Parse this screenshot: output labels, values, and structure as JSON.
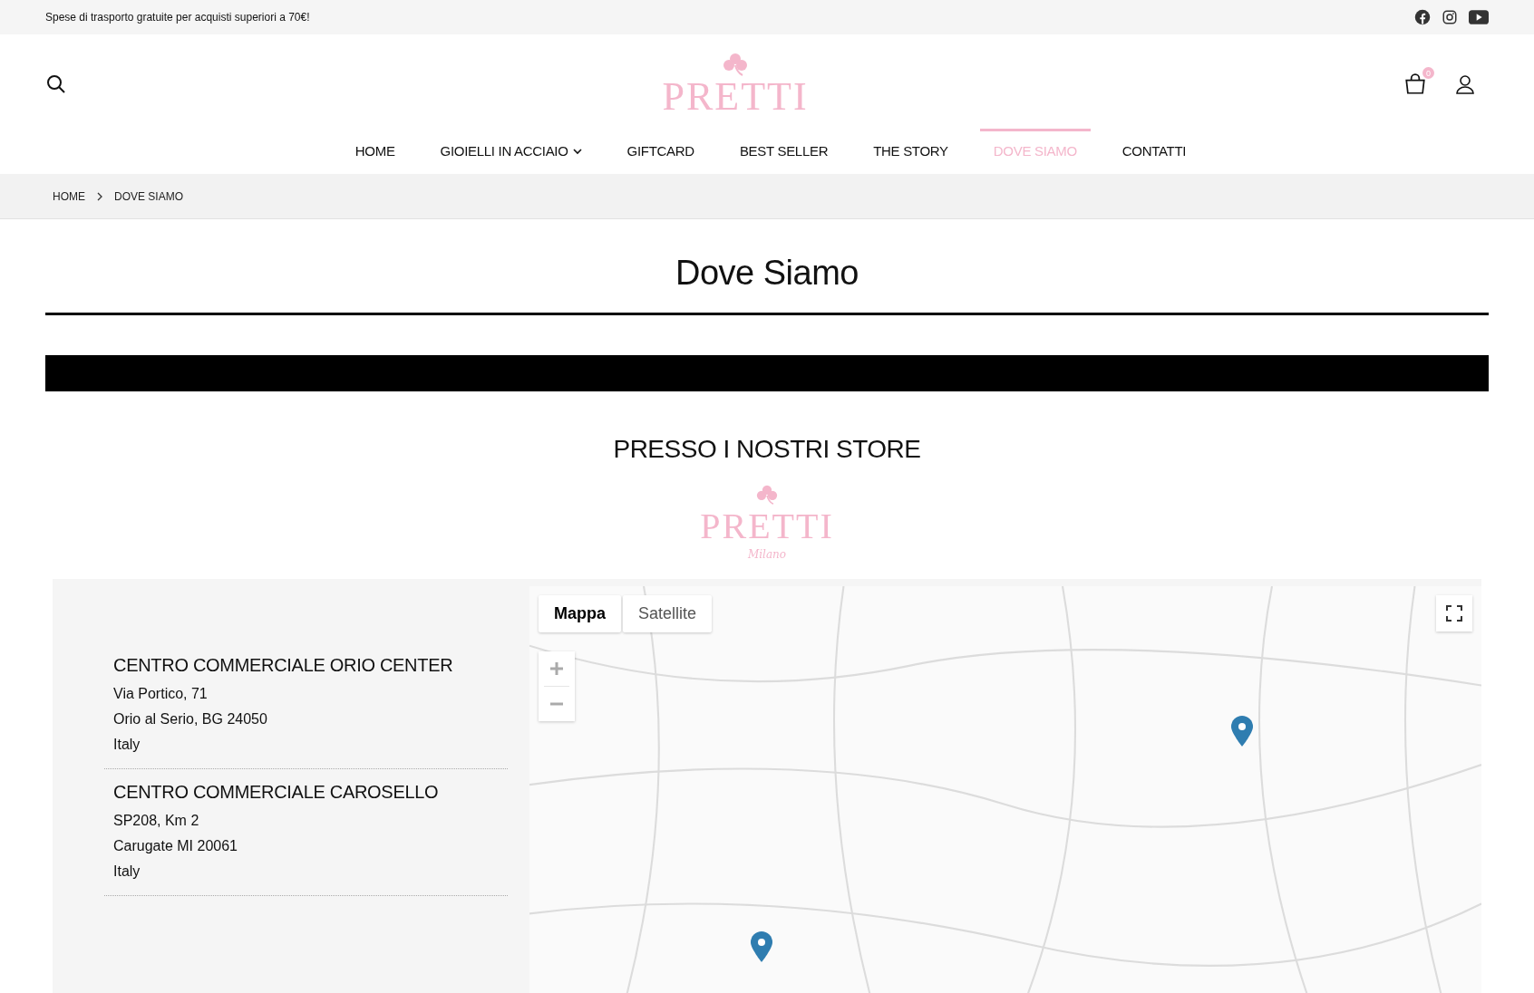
{
  "top_bar": {
    "text": "Spese di trasporto gratuite per acquisti superiori a 70€!"
  },
  "header": {
    "logo": {
      "wordmark": "PRETTI"
    },
    "cart_count": "0"
  },
  "nav": [
    {
      "label": "HOME",
      "selected": false,
      "dropdown": false
    },
    {
      "label": "GIOIELLI IN ACCIAIO",
      "selected": false,
      "dropdown": true
    },
    {
      "label": "GIFTCARD",
      "selected": false,
      "dropdown": false
    },
    {
      "label": "BEST SELLER",
      "selected": false,
      "dropdown": false
    },
    {
      "label": "THE STORY",
      "selected": false,
      "dropdown": false
    },
    {
      "label": "DOVE SIAMO",
      "selected": true,
      "dropdown": false
    },
    {
      "label": "CONTATTI",
      "selected": false,
      "dropdown": false
    }
  ],
  "breadcrumb": [
    "HOME",
    "DOVE SIAMO"
  ],
  "page_title": "Dove Siamo",
  "section_title": "PRESSO I NOSTRI STORE",
  "store_logo": {
    "wordmark": "PRETTI",
    "tagline": "Milano"
  },
  "stores": [
    {
      "name": "CENTRO COMMERCIALE ORIO CENTER",
      "lines": [
        "Via Portico, 71",
        "Orio al Serio, BG 24050",
        "Italy"
      ]
    },
    {
      "name": "CENTRO COMMERCIALE CAROSELLO",
      "lines": [
        "SP208, Km 2",
        "Carugate MI 20061",
        "Italy"
      ]
    }
  ],
  "map": {
    "types": [
      {
        "label": "Mappa",
        "selected": true
      },
      {
        "label": "Satellite",
        "selected": false
      }
    ]
  }
}
